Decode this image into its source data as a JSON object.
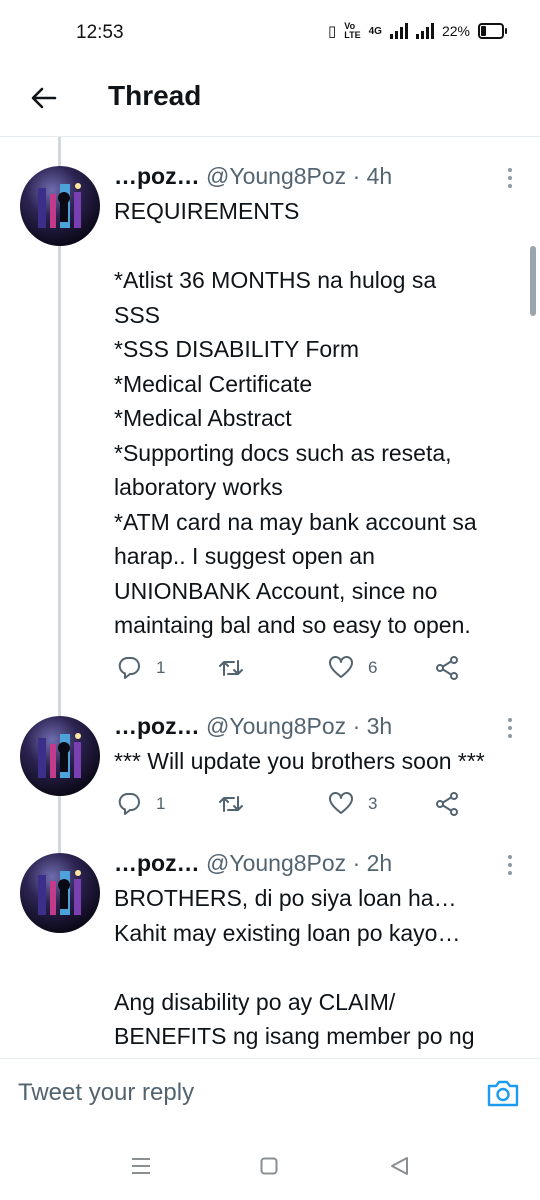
{
  "status_bar": {
    "time": "12:53",
    "volte_top": "Vo",
    "volte_bottom": "LTE",
    "network": "4G",
    "battery": "22%"
  },
  "header": {
    "title": "Thread",
    "back_icon": "arrow-left-icon"
  },
  "tweets": [
    {
      "name": "…poz…",
      "handle": "@Young8Poz",
      "separator": "·",
      "time": "4h",
      "lines": [
        "REQUIREMENTS",
        "",
        "*Atlist 36 MONTHS na hulog sa",
        "SSS",
        "*SSS DISABILITY Form",
        "*Medical Certificate",
        "*Medical Abstract",
        "*Supporting docs such as reseta,",
        "laboratory works",
        "*ATM card na may bank account sa",
        "harap.. I suggest open an",
        "UNIONBANK Account, since no",
        "maintaing bal and so easy to open."
      ],
      "reply_count": "1",
      "retweet_count": "",
      "like_count": "6"
    },
    {
      "name": "…poz…",
      "handle": "@Young8Poz",
      "separator": "·",
      "time": "3h",
      "lines": [
        "*** Will update you brothers soon ***"
      ],
      "reply_count": "1",
      "retweet_count": "",
      "like_count": "3"
    },
    {
      "name": "…poz…",
      "handle": "@Young8Poz",
      "separator": "·",
      "time": "2h",
      "lines": [
        "BROTHERS, di po siya loan ha…",
        "Kahit may existing loan po kayo…",
        "",
        "Ang disability po ay CLAIM/",
        "BENEFITS ng isang member po ng"
      ]
    }
  ],
  "reply_bar": {
    "placeholder": "Tweet your reply",
    "camera_icon": "camera-icon"
  },
  "colors": {
    "text": "#0f1419",
    "muted": "#536471",
    "accent": "#1d9bf0",
    "divider": "#e6ecf0",
    "thread_line": "#cfd9de"
  }
}
